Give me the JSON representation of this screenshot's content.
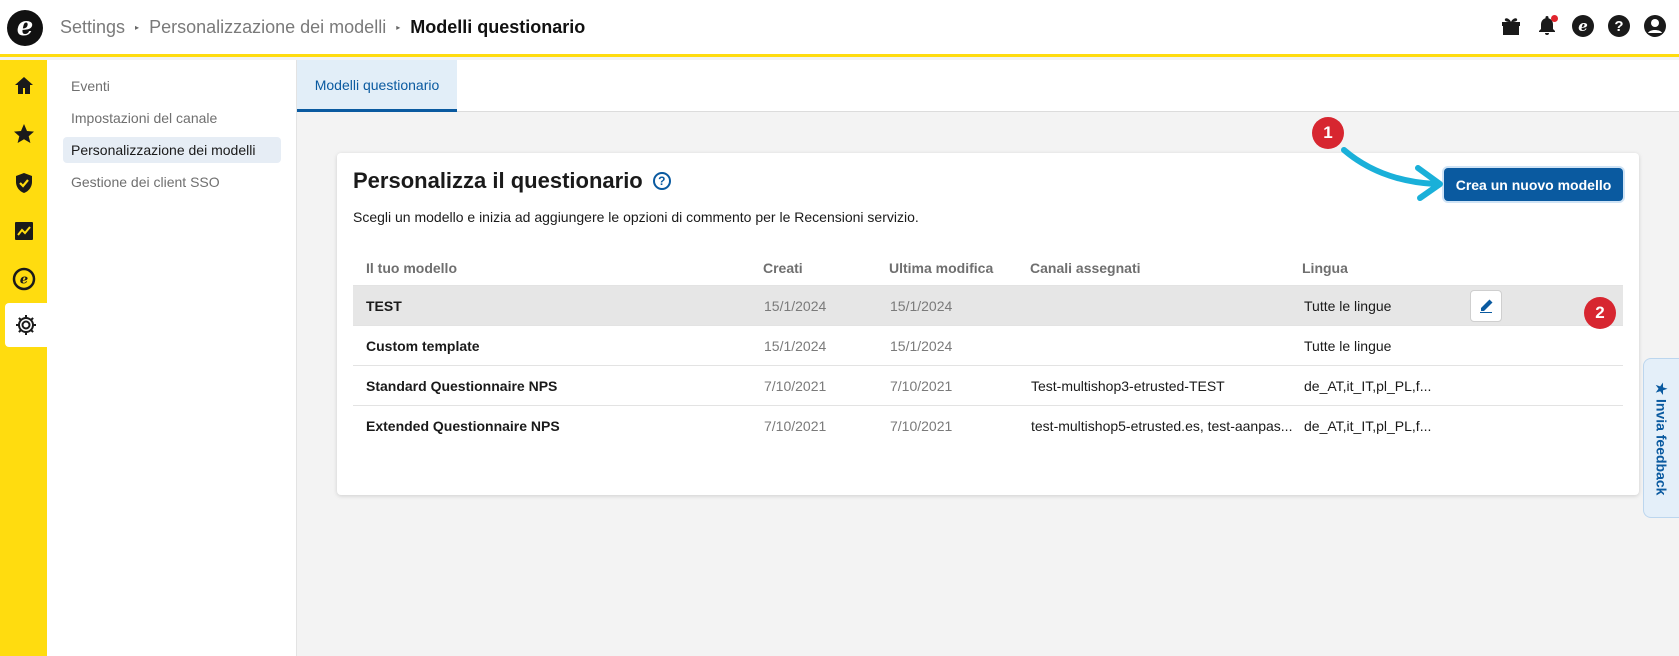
{
  "logo": {
    "glyph": "e"
  },
  "breadcrumb": {
    "items": [
      "Settings",
      "Personalizzazione dei modelli",
      "Modelli questionario"
    ],
    "separator": "▸"
  },
  "top_icons": [
    "gift-icon",
    "bell-icon",
    "brand-icon",
    "help-icon",
    "account-icon"
  ],
  "rail": {
    "items": [
      {
        "icon": "home-icon"
      },
      {
        "icon": "star-icon"
      },
      {
        "icon": "shield-check-icon"
      },
      {
        "icon": "analytics-icon"
      },
      {
        "icon": "brand-icon"
      },
      {
        "icon": "gear-icon",
        "active": true
      }
    ]
  },
  "subnav": {
    "items": [
      {
        "label": "Eventi"
      },
      {
        "label": "Impostazioni del canale"
      },
      {
        "label": "Personalizzazione dei modelli",
        "active": true
      },
      {
        "label": "Gestione dei client SSO"
      }
    ]
  },
  "tabs": [
    {
      "label": "Modelli questionario",
      "active": true
    }
  ],
  "card": {
    "title": "Personalizza il questionario",
    "help_glyph": "?",
    "description": "Scegli un modello e inizia ad aggiungere le opzioni di commento per le Recensioni servizio.",
    "create_button": "Crea un nuovo modello"
  },
  "table": {
    "headers": [
      "Il tuo modello",
      "Creati",
      "Ultima modifica",
      "Canali assegnati",
      "Lingua"
    ],
    "rows": [
      {
        "name": "TEST",
        "created": "15/1/2024",
        "modified": "15/1/2024",
        "channels": "",
        "language": "Tutte le lingue",
        "selected": true
      },
      {
        "name": "Custom template",
        "created": "15/1/2024",
        "modified": "15/1/2024",
        "channels": "",
        "language": "Tutte le lingue"
      },
      {
        "name": "Standard Questionnaire NPS",
        "created": "7/10/2021",
        "modified": "7/10/2021",
        "channels": "Test-multishop3-etrusted-TEST",
        "language": "de_AT,it_IT,pl_PL,f..."
      },
      {
        "name": "Extended Questionnaire NPS",
        "created": "7/10/2021",
        "modified": "7/10/2021",
        "channels": "test-multishop5-etrusted.es, test-aanpas...",
        "language": "de_AT,it_IT,pl_PL,f..."
      }
    ]
  },
  "annotations": {
    "badge1": "1",
    "badge2": "2"
  },
  "feedback_tab": {
    "label": "★ Invia feedback"
  },
  "colors": {
    "accent_yellow": "#ffdc0f",
    "primary_blue": "#0a5aa0",
    "badge_red": "#d72630",
    "arrow_cyan": "#1ab0d9"
  }
}
